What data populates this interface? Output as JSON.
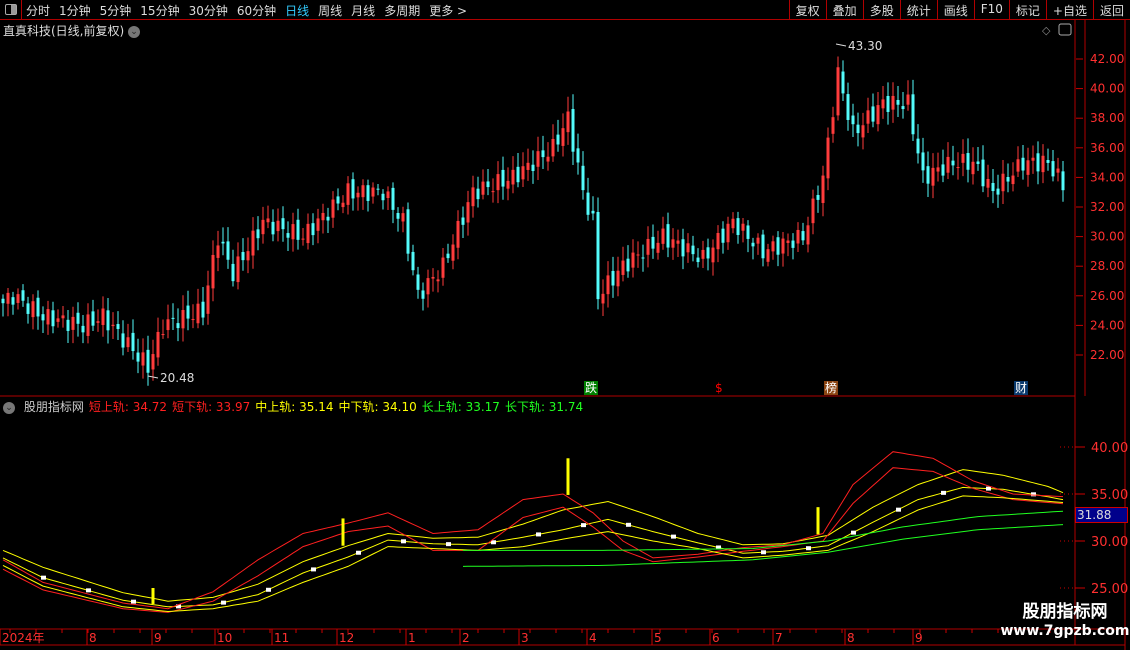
{
  "toolbar": {
    "periods": [
      "分时",
      "1分钟",
      "5分钟",
      "15分钟",
      "30分钟",
      "60分钟",
      "日线",
      "周线",
      "月线",
      "多周期",
      "更多 >"
    ],
    "active": "日线",
    "buttons": [
      "复权",
      "叠加",
      "多股",
      "统计",
      "画线",
      "F10",
      "标记",
      "+自选",
      "返回"
    ]
  },
  "stock_title": "直真科技(日线,前复权)",
  "price_axis": {
    "ticks": [
      "42.00",
      "40.00",
      "38.00",
      "36.00",
      "34.00",
      "32.00",
      "30.00",
      "28.00",
      "26.00",
      "24.00",
      "22.00"
    ],
    "max_label": "43.30",
    "min_label": "20.48"
  },
  "events": [
    {
      "label": "跌",
      "color": "#008000",
      "idx": 117
    },
    {
      "label": "$",
      "color": "#ff0000",
      "idx": 143
    },
    {
      "label": "榜",
      "color": "#8b4513",
      "idx": 165
    },
    {
      "label": "财",
      "color": "#0a3a6e",
      "idx": 203
    }
  ],
  "indicator": {
    "name": "股朋指标网",
    "values": [
      {
        "label": "短上轨: 34.72",
        "color": "#ff2020"
      },
      {
        "label": "短下轨: 33.97",
        "color": "#ff2020"
      },
      {
        "label": "中上轨: 35.14",
        "color": "#ffff00"
      },
      {
        "label": "中下轨: 34.10",
        "color": "#ffff00"
      },
      {
        "label": "长上轨: 33.17",
        "color": "#20ff20"
      },
      {
        "label": "长下轨: 31.74",
        "color": "#20ff20"
      }
    ],
    "axis_ticks": [
      "40.00",
      "35.00",
      "30.00",
      "25.00"
    ],
    "current": "31.88"
  },
  "date_axis": [
    "2024年",
    "8",
    "9",
    "10",
    "11",
    "12",
    "1",
    "2",
    "3",
    "4",
    "5",
    "6",
    "7",
    "8",
    "9"
  ],
  "watermark": {
    "line1": "股朋指标网",
    "line2": "www.7gpzb.com"
  },
  "chart_data": {
    "type": "candlestick",
    "price_range": [
      20,
      44
    ],
    "close_anchors": [
      [
        0,
        25.5
      ],
      [
        2,
        26
      ],
      [
        8,
        24.6
      ],
      [
        16,
        24
      ],
      [
        20,
        24.6
      ],
      [
        29,
        21.2
      ],
      [
        32,
        24
      ],
      [
        40,
        25
      ],
      [
        43,
        30
      ],
      [
        46,
        27.5
      ],
      [
        52,
        31
      ],
      [
        60,
        30
      ],
      [
        69,
        33
      ],
      [
        76,
        33
      ],
      [
        80,
        31
      ],
      [
        83,
        26
      ],
      [
        88,
        28
      ],
      [
        94,
        33
      ],
      [
        102,
        34
      ],
      [
        110,
        36
      ],
      [
        113,
        38
      ],
      [
        116,
        33
      ],
      [
        118,
        31
      ],
      [
        119,
        26
      ],
      [
        124,
        28
      ],
      [
        132,
        30
      ],
      [
        140,
        28.5
      ],
      [
        146,
        31
      ],
      [
        152,
        29
      ],
      [
        160,
        30
      ],
      [
        164,
        34
      ],
      [
        167,
        41
      ],
      [
        170,
        37
      ],
      [
        176,
        39
      ],
      [
        181,
        39
      ],
      [
        184,
        34
      ],
      [
        190,
        35
      ],
      [
        194,
        35
      ],
      [
        198,
        33
      ],
      [
        204,
        35
      ],
      [
        209,
        35
      ],
      [
        212,
        33.5
      ]
    ],
    "indicator_range": [
      24,
      44
    ],
    "series": [
      {
        "name": "中轨",
        "color": "#ffff00",
        "points": [
          [
            0,
            28.2
          ],
          [
            8,
            26.1
          ],
          [
            24,
            23.7
          ],
          [
            33,
            23
          ],
          [
            42,
            23.2
          ],
          [
            51,
            24.3
          ],
          [
            60,
            26.6
          ],
          [
            69,
            28.3
          ],
          [
            77,
            30.1
          ],
          [
            86,
            29.7
          ],
          [
            95,
            29.6
          ],
          [
            104,
            30.4
          ],
          [
            112,
            31.2
          ],
          [
            121,
            32.3
          ],
          [
            130,
            31
          ],
          [
            139,
            29.8
          ],
          [
            148,
            28.7
          ],
          [
            156,
            28.9
          ],
          [
            165,
            29.5
          ],
          [
            174,
            32
          ],
          [
            183,
            34.4
          ],
          [
            192,
            35.7
          ],
          [
            200,
            35.5
          ],
          [
            209,
            34.7
          ],
          [
            212,
            34.4
          ]
        ]
      },
      {
        "name": "中上轨",
        "color": "#ffff00",
        "points": [
          [
            0,
            29
          ],
          [
            8,
            27.2
          ],
          [
            24,
            24.5
          ],
          [
            33,
            23.6
          ],
          [
            42,
            24
          ],
          [
            51,
            25.4
          ],
          [
            60,
            27.8
          ],
          [
            69,
            29.5
          ],
          [
            77,
            30.8
          ],
          [
            86,
            30.3
          ],
          [
            95,
            30.4
          ],
          [
            104,
            31.8
          ],
          [
            112,
            33.3
          ],
          [
            121,
            34.2
          ],
          [
            130,
            32.6
          ],
          [
            139,
            30.8
          ],
          [
            148,
            29.6
          ],
          [
            156,
            29.7
          ],
          [
            165,
            30.6
          ],
          [
            174,
            33.6
          ],
          [
            183,
            36
          ],
          [
            192,
            37.6
          ],
          [
            200,
            37
          ],
          [
            209,
            35.8
          ],
          [
            212,
            35.14
          ]
        ]
      },
      {
        "name": "短上轨",
        "color": "#ff2020",
        "points": [
          [
            0,
            28
          ],
          [
            8,
            25.6
          ],
          [
            24,
            23.4
          ],
          [
            33,
            22.8
          ],
          [
            42,
            24.6
          ],
          [
            51,
            28
          ],
          [
            60,
            30.8
          ],
          [
            69,
            31.9
          ],
          [
            77,
            33
          ],
          [
            86,
            30.8
          ],
          [
            95,
            31.2
          ],
          [
            104,
            34.4
          ],
          [
            112,
            35
          ],
          [
            118,
            33
          ],
          [
            124,
            30
          ],
          [
            130,
            28.2
          ],
          [
            139,
            28.6
          ],
          [
            148,
            29.3
          ],
          [
            156,
            29.6
          ],
          [
            164,
            30.8
          ],
          [
            170,
            36
          ],
          [
            178,
            39.5
          ],
          [
            186,
            38.8
          ],
          [
            194,
            36.4
          ],
          [
            202,
            35
          ],
          [
            212,
            34.72
          ]
        ]
      },
      {
        "name": "短下轨",
        "color": "#ff2020",
        "points": [
          [
            0,
            27
          ],
          [
            8,
            24.8
          ],
          [
            24,
            22.8
          ],
          [
            33,
            22.4
          ],
          [
            42,
            23.6
          ],
          [
            51,
            26.3
          ],
          [
            60,
            29.4
          ],
          [
            69,
            31
          ],
          [
            77,
            31.6
          ],
          [
            86,
            29
          ],
          [
            95,
            29
          ],
          [
            104,
            32.5
          ],
          [
            112,
            33.6
          ],
          [
            118,
            31.5
          ],
          [
            124,
            29
          ],
          [
            130,
            27.8
          ],
          [
            139,
            28.3
          ],
          [
            148,
            28.9
          ],
          [
            156,
            29.4
          ],
          [
            164,
            30
          ],
          [
            170,
            34
          ],
          [
            178,
            37.8
          ],
          [
            186,
            37.4
          ],
          [
            194,
            35.6
          ],
          [
            202,
            34.4
          ],
          [
            212,
            33.97
          ]
        ]
      },
      {
        "name": "中下轨",
        "color": "#ffff00",
        "points": [
          [
            0,
            27.4
          ],
          [
            8,
            25.2
          ],
          [
            24,
            23
          ],
          [
            33,
            22.5
          ],
          [
            42,
            22.8
          ],
          [
            51,
            23.6
          ],
          [
            60,
            25.6
          ],
          [
            69,
            27.3
          ],
          [
            77,
            29.4
          ],
          [
            86,
            29.2
          ],
          [
            95,
            29
          ],
          [
            104,
            29.4
          ],
          [
            112,
            30.2
          ],
          [
            121,
            31
          ],
          [
            130,
            30
          ],
          [
            139,
            29.2
          ],
          [
            148,
            28.2
          ],
          [
            156,
            28.5
          ],
          [
            165,
            29
          ],
          [
            174,
            31
          ],
          [
            183,
            33.3
          ],
          [
            192,
            34.8
          ],
          [
            200,
            34.6
          ],
          [
            212,
            34.1
          ]
        ]
      },
      {
        "name": "长上轨",
        "color": "#20ff20",
        "points": [
          [
            92,
            29
          ],
          [
            120,
            29
          ],
          [
            150,
            29.2
          ],
          [
            165,
            30
          ],
          [
            180,
            31.5
          ],
          [
            195,
            32.6
          ],
          [
            212,
            33.17
          ]
        ]
      },
      {
        "name": "长下轨",
        "color": "#20ff20",
        "points": [
          [
            92,
            27.3
          ],
          [
            120,
            27.4
          ],
          [
            150,
            28
          ],
          [
            165,
            28.8
          ],
          [
            180,
            30.2
          ],
          [
            195,
            31.2
          ],
          [
            212,
            31.74
          ]
        ]
      }
    ],
    "signal_bars": [
      [
        30,
        23.3,
        25
      ],
      [
        68,
        29.5,
        32.4
      ],
      [
        113,
        34.9,
        38.8
      ],
      [
        163,
        30.7,
        33.6
      ]
    ]
  }
}
